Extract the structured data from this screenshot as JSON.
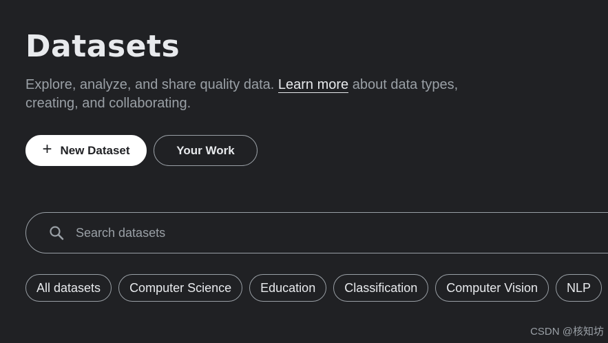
{
  "header": {
    "title": "Datasets",
    "description_before": "Explore, analyze, and share quality data. ",
    "learn_more_link": "Learn more",
    "description_after": " about data types, creating, and collaborating."
  },
  "actions": {
    "new_dataset_icon": "plus-icon",
    "new_dataset_label": "New Dataset",
    "your_work_label": "Your Work"
  },
  "search": {
    "icon": "search-icon",
    "placeholder": "Search datasets",
    "value": ""
  },
  "filters": [
    {
      "label": "All datasets"
    },
    {
      "label": "Computer Science"
    },
    {
      "label": "Education"
    },
    {
      "label": "Classification"
    },
    {
      "label": "Computer Vision"
    },
    {
      "label": "NLP"
    }
  ],
  "watermark": "CSDN @核知坊",
  "colors": {
    "background": "#202124",
    "text_primary": "#e8eaed",
    "text_secondary": "#9aa0a6",
    "primary_button_bg": "#ffffff"
  }
}
